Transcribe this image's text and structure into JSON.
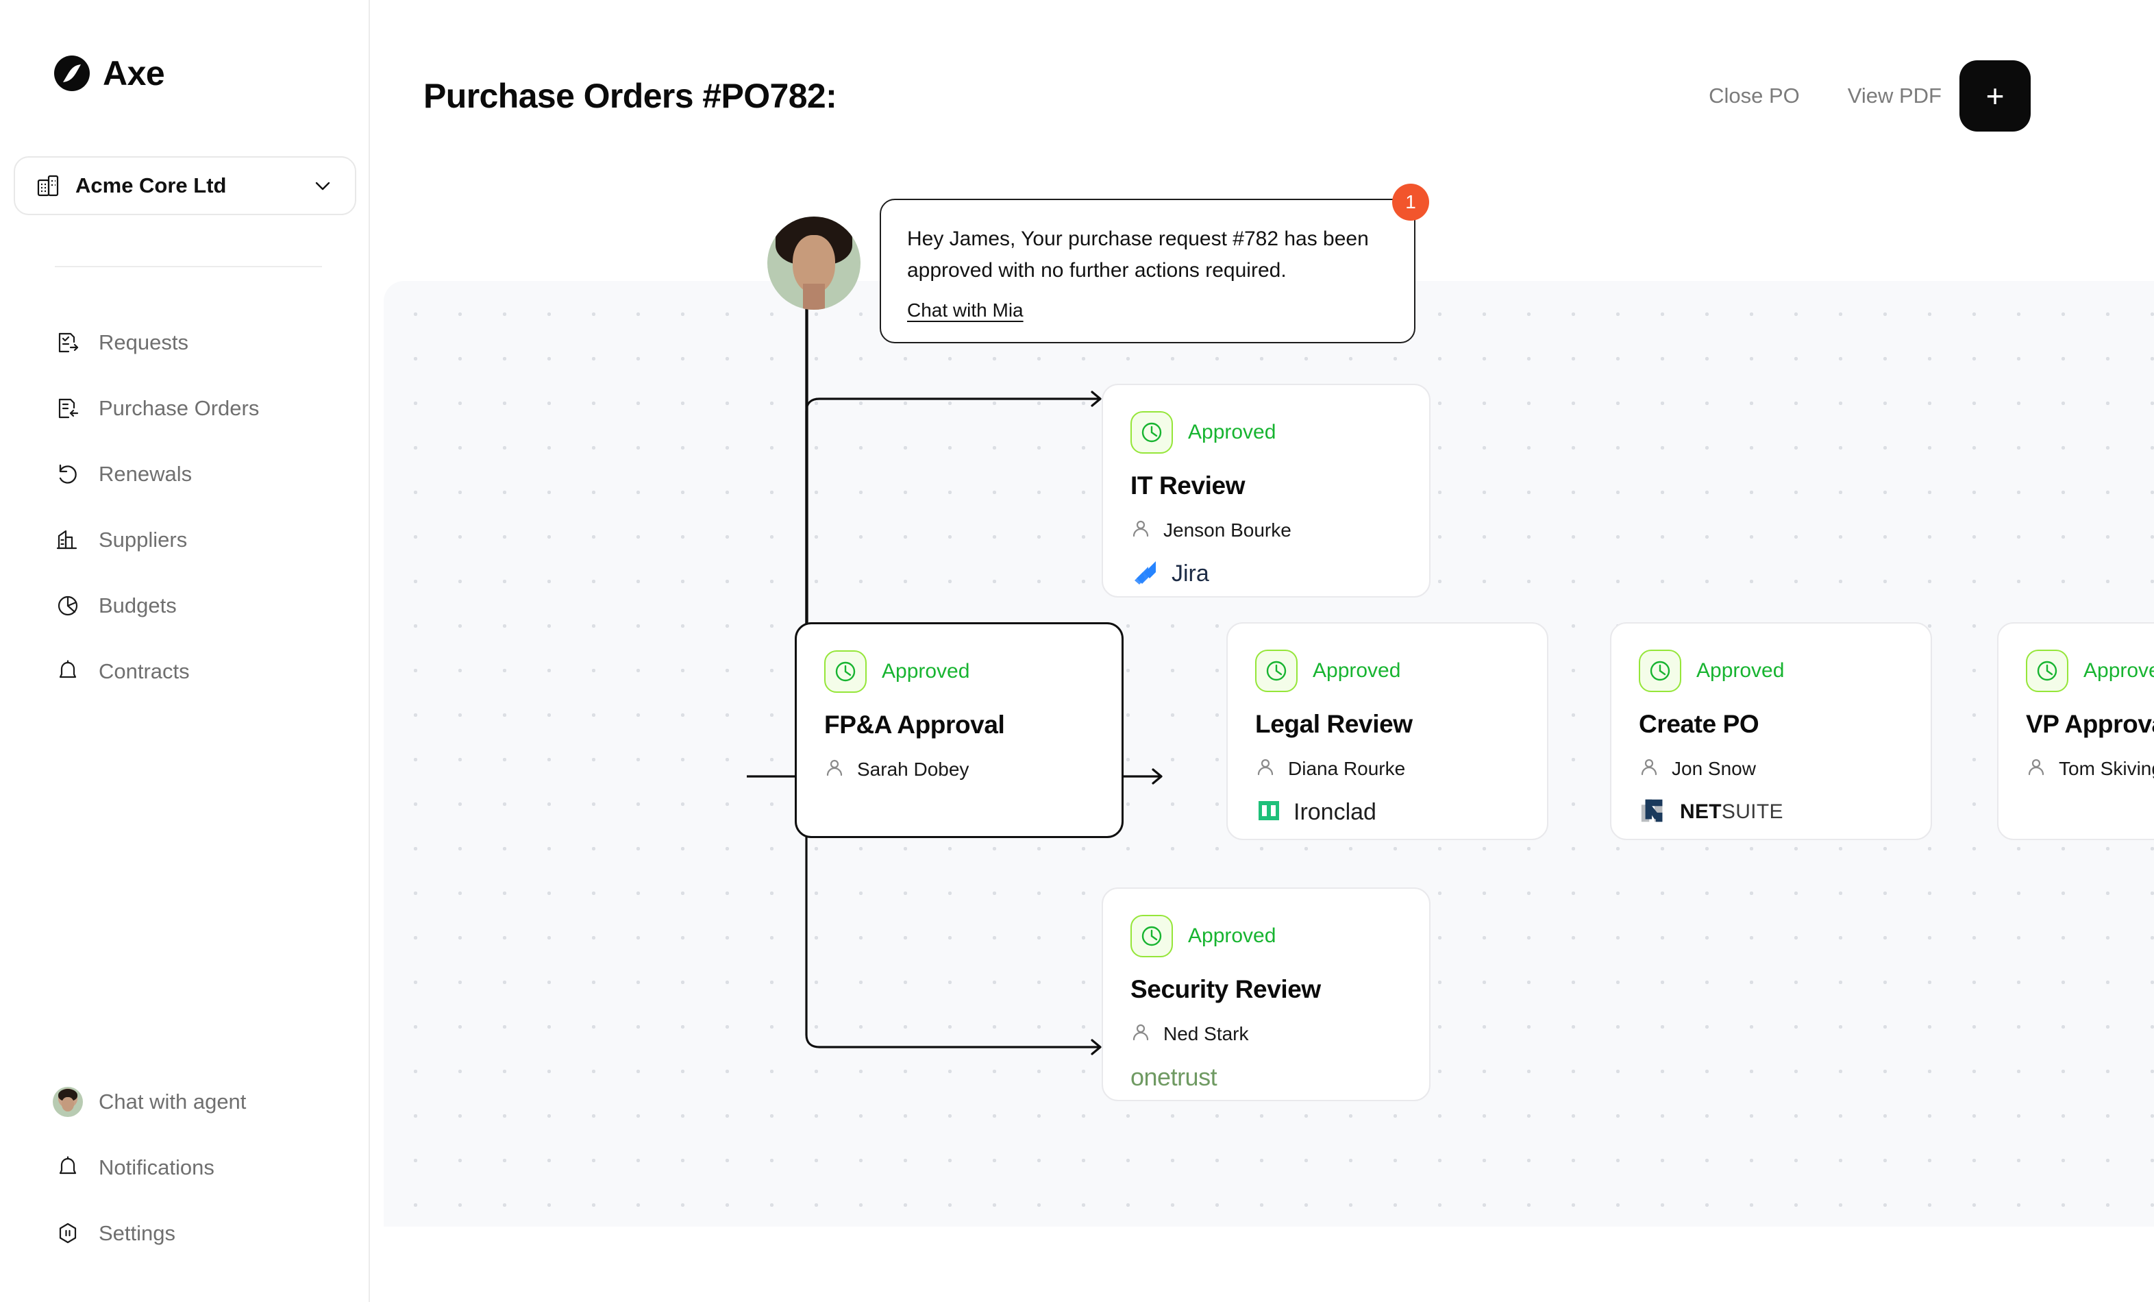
{
  "brand": {
    "name": "Axe",
    "logo_icon": "axe-circle-logo"
  },
  "org_switcher": {
    "name": "Acme Core Ltd",
    "icon": "building-icon",
    "chevron_icon": "chevron-down-icon"
  },
  "sidebar": {
    "items": [
      {
        "label": "Requests",
        "icon": "document-arrow-right-icon"
      },
      {
        "label": "Purchase Orders",
        "icon": "document-arrow-left-icon"
      },
      {
        "label": "Renewals",
        "icon": "rotate-ccw-icon"
      },
      {
        "label": "Suppliers",
        "icon": "building-icon"
      },
      {
        "label": "Budgets",
        "icon": "pie-chart-icon"
      },
      {
        "label": "Contracts",
        "icon": "bell-icon"
      }
    ],
    "bottom_items": [
      {
        "label": "Chat with agent",
        "icon": "agent-avatar-icon"
      },
      {
        "label": "Notifications",
        "icon": "bell-icon"
      },
      {
        "label": "Settings",
        "icon": "hexagon-pause-icon"
      }
    ]
  },
  "header": {
    "title": "Purchase Orders #PO782:",
    "actions": [
      {
        "label": "Close PO"
      },
      {
        "label": "View PDF"
      }
    ],
    "add_button": {
      "label": "+",
      "icon": "plus-icon"
    }
  },
  "message": {
    "badge_count": "1",
    "avatar_icon": "agent-avatar-icon",
    "text": "Hey James, Your purchase request #782 has been approved with no further actions required.",
    "link_label": "Chat with Mia"
  },
  "workflow": {
    "status_icon": "clock-icon",
    "assignee_icon": "person-icon",
    "nodes": [
      {
        "id": "fpa",
        "status": "Approved",
        "title": "FP&A Approval",
        "assignee": "Sarah Dobey",
        "integration": null,
        "selected": true
      },
      {
        "id": "it",
        "status": "Approved",
        "title": "IT Review",
        "assignee": "Jenson Bourke",
        "integration": {
          "name": "Jira",
          "icon": "jira-logo"
        },
        "selected": false
      },
      {
        "id": "legal",
        "status": "Approved",
        "title": "Legal Review",
        "assignee": "Diana Rourke",
        "integration": {
          "name": "Ironclad",
          "icon": "ironclad-logo"
        },
        "selected": false
      },
      {
        "id": "security",
        "status": "Approved",
        "title": "Security Review",
        "assignee": "Ned Stark",
        "integration": {
          "name": "onetrust",
          "icon": "onetrust-logo"
        },
        "selected": false
      },
      {
        "id": "createpo",
        "status": "Approved",
        "title": "Create PO",
        "assignee": "Jon Snow",
        "integration": {
          "name_bold": "NET",
          "name_rest": "SUITE",
          "icon": "netsuite-logo"
        },
        "selected": false
      },
      {
        "id": "vp",
        "status": "Approved",
        "title": "VP Approval",
        "assignee": "Tom Skivington",
        "integration": null,
        "selected": false
      }
    ]
  },
  "colors": {
    "status_green_text": "#17b430",
    "status_green_border": "#95e639",
    "status_green_bg": "#f4fde9",
    "badge_orange": "#f2552c",
    "canvas_bg": "#f8f9fb",
    "jira_blue": "#2684ff",
    "ironclad_green": "#1fc07a",
    "onetrust_green": "#6f9a62",
    "netsuite_navy": "#1b3a5c"
  }
}
